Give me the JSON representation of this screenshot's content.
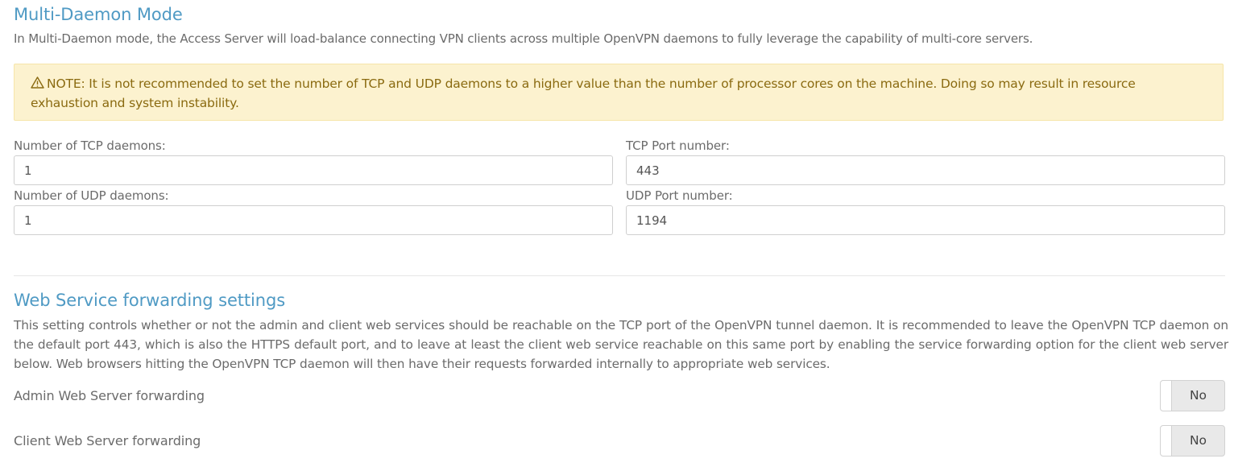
{
  "multi_daemon": {
    "title": "Multi-Daemon Mode",
    "description": "In Multi-Daemon mode, the Access Server will load-balance connecting VPN clients across multiple OpenVPN daemons to fully leverage the capability of multi-core servers.",
    "note_icon": "warning-triangle-icon",
    "note_text": "NOTE: It is not recommended to set the number of TCP and UDP daemons to a higher value than the number of processor cores on the machine. Doing so may result in resource exhaustion and system instability.",
    "fields": {
      "tcp_daemons": {
        "label": "Number of TCP daemons:",
        "value": "1"
      },
      "tcp_port": {
        "label": "TCP Port number:",
        "value": "443"
      },
      "udp_daemons": {
        "label": "Number of UDP daemons:",
        "value": "1"
      },
      "udp_port": {
        "label": "UDP Port number:",
        "value": "1194"
      }
    }
  },
  "web_forwarding": {
    "title": "Web Service forwarding settings",
    "description": "This setting controls whether or not the admin and client web services should be reachable on the TCP port of the OpenVPN tunnel daemon. It is recommended to leave the OpenVPN TCP daemon on the default port 443, which is also the HTTPS default port, and to leave at least the client web service reachable on this same port by enabling the service forwarding option for the client web server below. Web browsers hitting the OpenVPN TCP daemon will then have their requests forwarded internally to appropriate web services.",
    "admin": {
      "label": "Admin Web Server forwarding",
      "state": "No"
    },
    "client": {
      "label": "Client Web Server forwarding",
      "state": "No"
    }
  },
  "colors": {
    "accent": "#4f9ac4",
    "note_background": "#fcf2cf",
    "note_text": "#8a6a10"
  }
}
